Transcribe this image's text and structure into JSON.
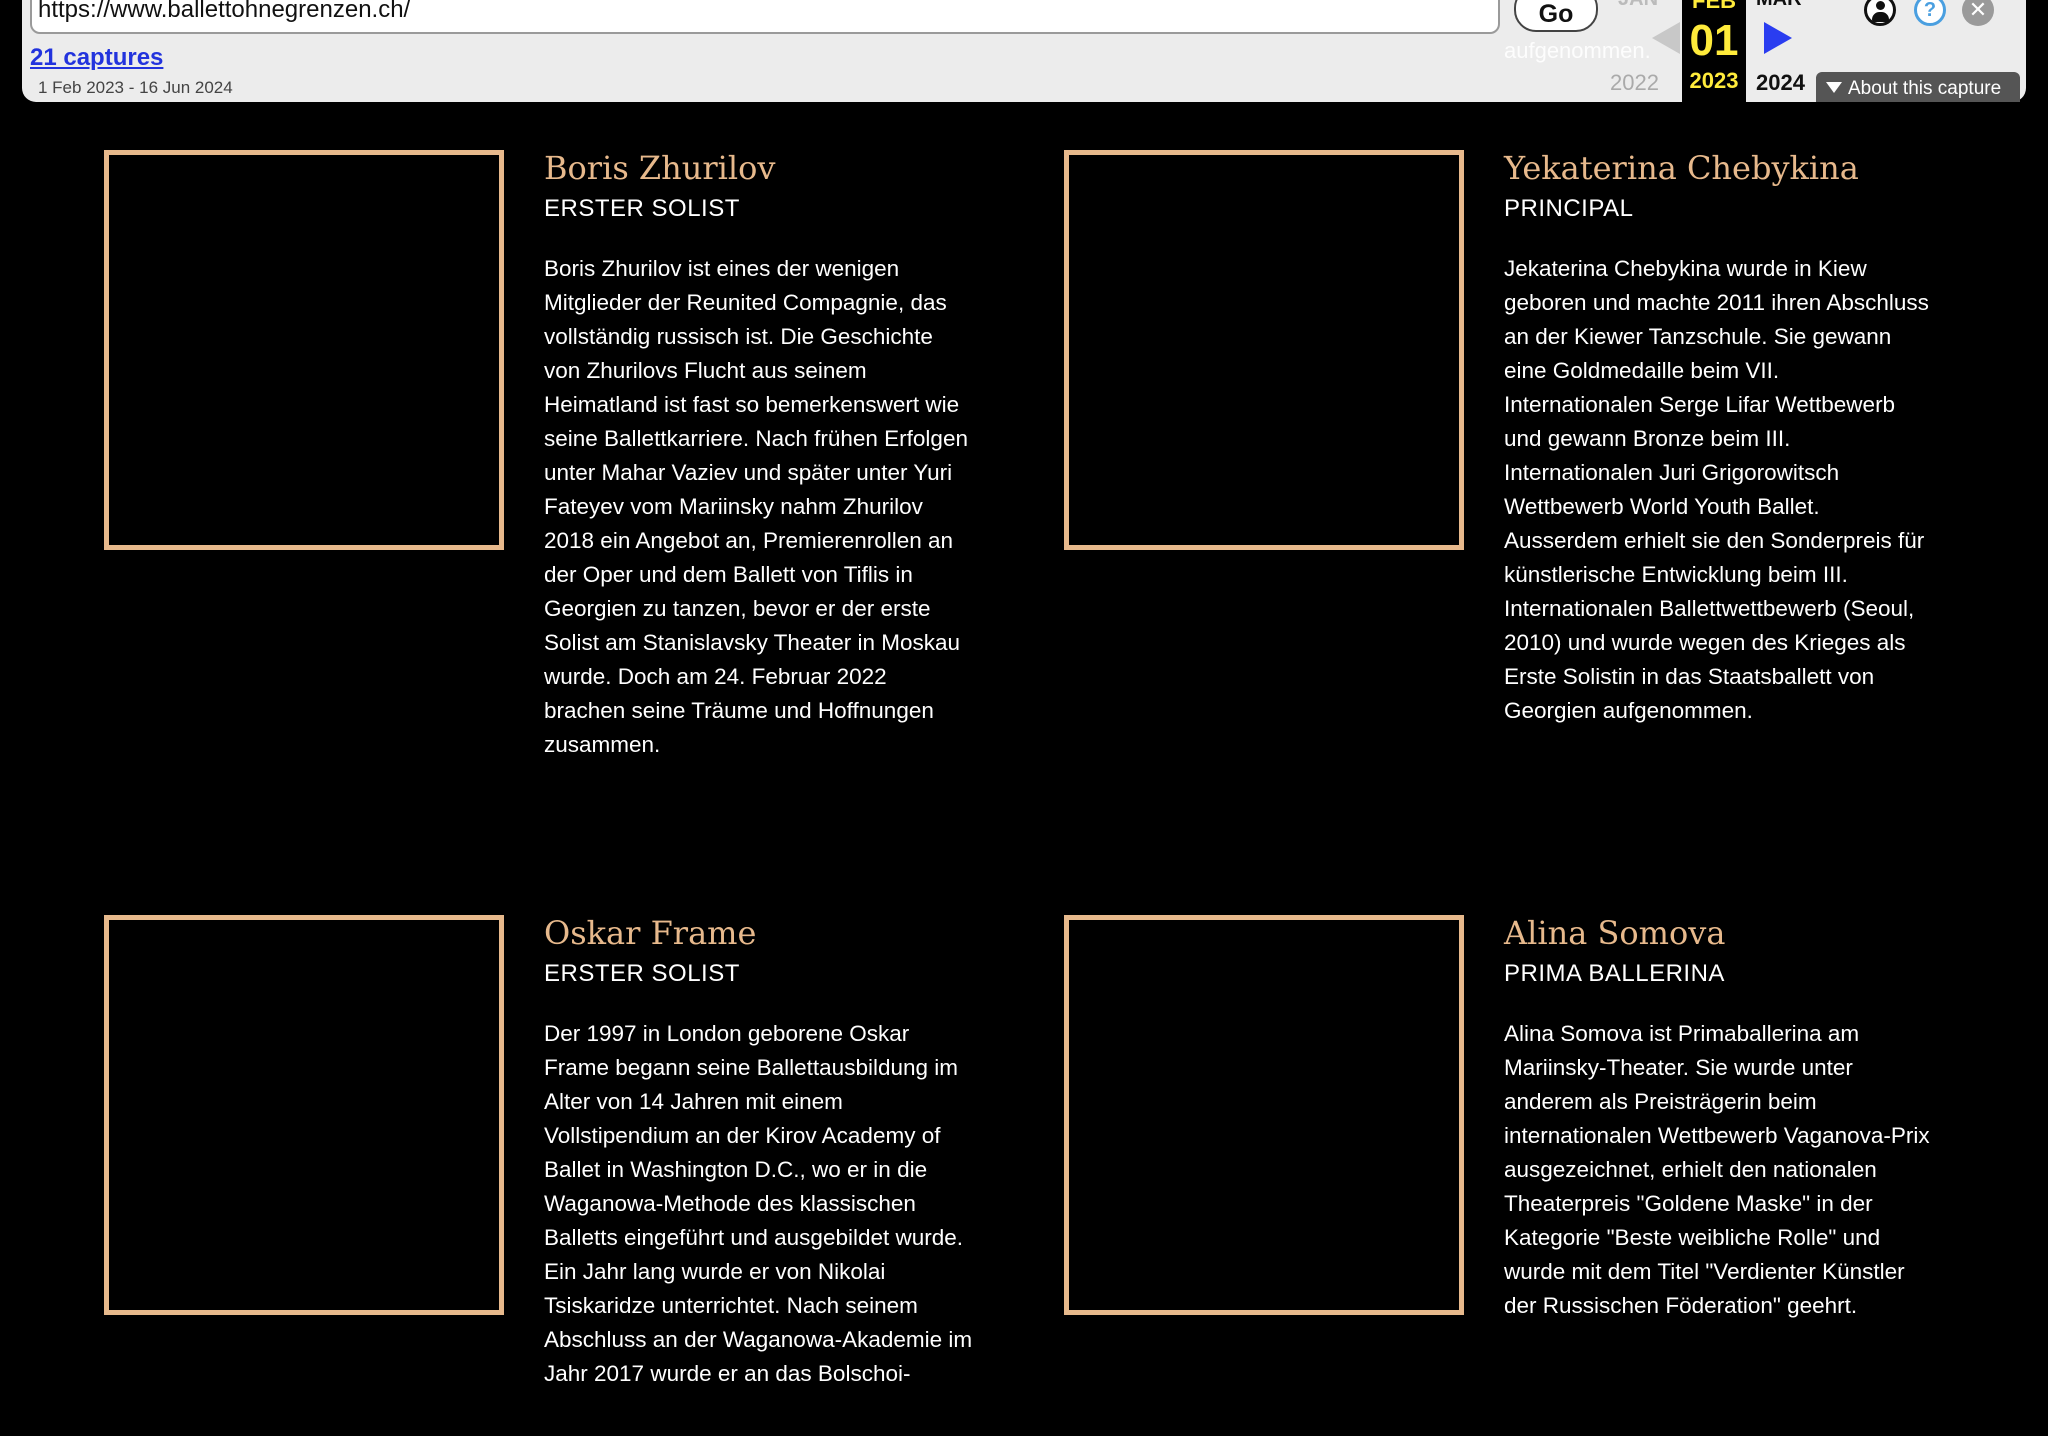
{
  "toolbar": {
    "url": "https://www.ballettohnegrenzen.ch/",
    "go_label": "Go",
    "captures_label": "21 captures",
    "date_range": "1 Feb 2023 - 16 Jun 2024",
    "bleed_text": "aufgenommen.",
    "prev_month": "JAN",
    "prev_year": "2022",
    "current_month": "FEB",
    "current_day": "01",
    "current_year": "2023",
    "next_month": "MAR",
    "next_year": "2024",
    "about_label": "About this capture",
    "help_glyph": "?",
    "close_glyph": "✕",
    "colors": {
      "highlight": "#ffeb3b",
      "next_arrow": "#2a3df0",
      "captures_link": "#2233dd"
    }
  },
  "dancers": [
    {
      "name": "Boris Zhurilov",
      "role": "ERSTER SOLIST",
      "bio": "Boris Zhurilov ist eines der wenigen Mitglieder der Reunited Compagnie, das vollständig russisch ist. Die Geschichte von Zhurilovs Flucht aus seinem Heimatland ist fast so bemerkenswert wie seine Ballettkarriere. Nach frühen Erfolgen unter Mahar Vaziev und später unter Yuri Fateyev vom Mariinsky nahm Zhurilov 2018 ein Angebot an, Premierenrollen an der Oper und dem Ballett von Tiflis in Georgien zu tanzen, bevor er der erste Solist am Stanislavsky Theater in Moskau wurde. Doch am 24. Februar 2022 brachen seine Träume und Hoffnungen zusammen."
    },
    {
      "name": "Yekaterina Chebykina",
      "role": "PRINCIPAL",
      "bio": "Jekaterina Chebykina wurde in Kiew geboren und machte 2011 ihren Abschluss an der Kiewer Tanzschule. Sie gewann eine Goldmedaille beim VII. Internationalen Serge Lifar Wettbewerb und gewann Bronze beim III. Internationalen Juri Grigorowitsch Wettbewerb World Youth Ballet. Ausserdem erhielt sie den Sonderpreis für künstlerische Entwicklung beim III. Internationalen Ballettwettbewerb (Seoul, 2010) und wurde wegen des Krieges als Erste Solistin in das Staatsballett von Georgien aufgenommen."
    },
    {
      "name": "Oskar Frame",
      "role": "ERSTER SOLIST",
      "bio": "Der 1997 in London geborene Oskar Frame begann seine Ballettausbildung im Alter von 14 Jahren mit einem Vollstipendium an der Kirov Academy of Ballet in Washington D.C., wo er in die Waganowa-Methode des klassischen Balletts eingeführt und ausgebildet wurde. Ein Jahr lang wurde er von Nikolai Tsiskaridze unterrichtet. Nach seinem Abschluss an der Waganowa-Akademie im Jahr 2017 wurde er an das Bolschoi-"
    },
    {
      "name": "Alina Somova",
      "role": "PRIMA BALLERINA",
      "bio": "Alina Somova ist Primaballerina am Mariinsky-Theater. Sie wurde unter anderem als Preisträgerin beim internationalen Wettbewerb Vaganova-Prix ausgezeichnet, erhielt den nationalen Theaterpreis \"Goldene Maske\" in der Kategorie \"Beste weibliche Rolle\" und wurde mit dem Titel \"Verdienter Künstler der Russischen Föderation\" geehrt."
    }
  ],
  "colors": {
    "background": "#000000",
    "accent_gold": "#e7b98c",
    "text": "#ffffff"
  }
}
